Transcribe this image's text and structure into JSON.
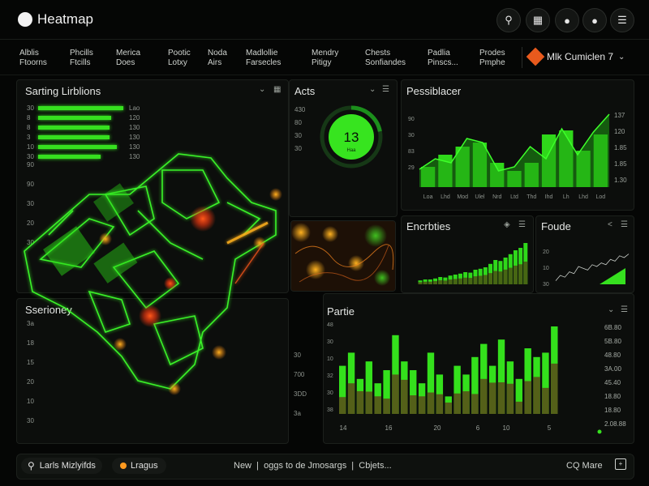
{
  "app": {
    "title": "Heatmap"
  },
  "topbar_icons": [
    "search-icon",
    "grid-icon",
    "bell-icon",
    "user-icon",
    "menu-icon"
  ],
  "nav": {
    "items": [
      {
        "line1": "Alblis",
        "line2": "Ftoorns"
      },
      {
        "line1": "Phcills",
        "line2": "Ftcills"
      },
      {
        "line1": "Merica",
        "line2": "Does"
      },
      {
        "line1": "Pootic",
        "line2": "Lotxy"
      },
      {
        "line1": "Noda",
        "line2": "Airs"
      },
      {
        "line1": "Madlollie",
        "line2": "Farsecles"
      },
      {
        "line1": "Mendry",
        "line2": "Pitigy"
      },
      {
        "line1": "Chests",
        "line2": "Sonfiandes"
      },
      {
        "line1": "Padlia",
        "line2": "Pinscs..."
      },
      {
        "line1": "Prodes",
        "line2": "Pmphe"
      }
    ],
    "profile": "Mlk Cumiclen 7"
  },
  "panels": {
    "sorting": {
      "title": "Sarting Lirblions",
      "rows": [
        {
          "label": "30",
          "value": 0.95,
          "tag": "Lao"
        },
        {
          "label": "8",
          "value": 0.82,
          "tag": "120"
        },
        {
          "label": "8",
          "value": 0.8,
          "tag": "130"
        },
        {
          "label": "3",
          "value": 0.8,
          "tag": "130"
        },
        {
          "label": "10",
          "value": 0.88,
          "tag": "130"
        },
        {
          "label": "30",
          "value": 0.7,
          "tag": "130"
        }
      ],
      "axis": [
        "90",
        "90",
        "30",
        "20",
        "30"
      ]
    },
    "acts": {
      "title": "Acts",
      "gauge_value": "13",
      "gauge_sub": "Haa",
      "gauge_fraction": 0.22,
      "axis": [
        "430",
        "80",
        "30",
        "30"
      ]
    },
    "pessimizer": {
      "title": "Pessiblacer",
      "y_right": [
        "137",
        "120",
        "1.85",
        "1.85",
        "1.30"
      ],
      "y_left": [
        "90",
        "30",
        "83",
        "29"
      ],
      "x_labels": [
        "Loa",
        "Lhd",
        "Mod",
        "Ulel",
        "Nrd",
        "Ltd",
        "Thd",
        "Ihd",
        "Lh",
        "Lhd",
        "Lod"
      ]
    },
    "encrables": {
      "title": "Encrbties"
    },
    "fonde": {
      "title": "Foude",
      "labels": [
        "20",
        "10",
        "30"
      ]
    },
    "sanitory": {
      "title": "Sserioney",
      "axis": [
        "3a",
        "18",
        "15",
        "20",
        "10",
        "30"
      ]
    },
    "center_axis": [
      "30",
      "700",
      "3DD",
      "3a"
    ],
    "partie": {
      "title": "Partie",
      "y_right": [
        "6B.80",
        "5B.80",
        "48.80",
        "3A.00",
        "45.40",
        "18.80",
        "18.80",
        "2.08.88"
      ],
      "y_left": [
        "48",
        "30",
        "10",
        "32",
        "30",
        "38"
      ],
      "x_labels": [
        "14",
        "16",
        "20",
        "6",
        "10",
        "5"
      ]
    }
  },
  "statusbar": {
    "search_label": "Larls Mizlyifds",
    "tag_label": "Lragus",
    "message": "New  |  oggs to de Jmosargs  |  Cbjets...",
    "right_label": "CQ Mare"
  },
  "chart_data": [
    {
      "type": "bar",
      "title": "Pessiblacer",
      "categories": [
        "Loa",
        "Lhd",
        "Mod",
        "Ulel",
        "Nrd",
        "Ltd",
        "Thd",
        "Ihd",
        "Lh",
        "Lhd",
        "Lod"
      ],
      "values": [
        0.25,
        0.4,
        0.5,
        0.55,
        0.3,
        0.2,
        0.3,
        0.65,
        0.7,
        0.45,
        0.65
      ],
      "line": [
        0.22,
        0.35,
        0.3,
        0.6,
        0.55,
        0.2,
        0.25,
        0.5,
        0.35,
        0.72,
        0.4,
        0.68,
        0.9
      ]
    },
    {
      "type": "bar",
      "title": "Encrbties",
      "values": [
        0.08,
        0.1,
        0.1,
        0.12,
        0.15,
        0.14,
        0.18,
        0.2,
        0.22,
        0.25,
        0.24,
        0.3,
        0.32,
        0.35,
        0.42,
        0.5,
        0.48,
        0.55,
        0.62,
        0.7,
        0.75,
        0.85
      ]
    },
    {
      "type": "line",
      "title": "Foude",
      "values": [
        0.1,
        0.25,
        0.2,
        0.35,
        0.3,
        0.5,
        0.45,
        0.4,
        0.55,
        0.5,
        0.6,
        0.55,
        0.7,
        0.65,
        0.8,
        0.75,
        0.85
      ]
    },
    {
      "type": "bar",
      "title": "Partie",
      "values": [
        0.55,
        0.7,
        0.4,
        0.6,
        0.35,
        0.5,
        0.9,
        0.6,
        0.5,
        0.35,
        0.7,
        0.45,
        0.2,
        0.55,
        0.45,
        0.65,
        0.8,
        0.55,
        0.85,
        0.6,
        0.4,
        0.75,
        0.65,
        0.7,
        1.0
      ]
    }
  ]
}
